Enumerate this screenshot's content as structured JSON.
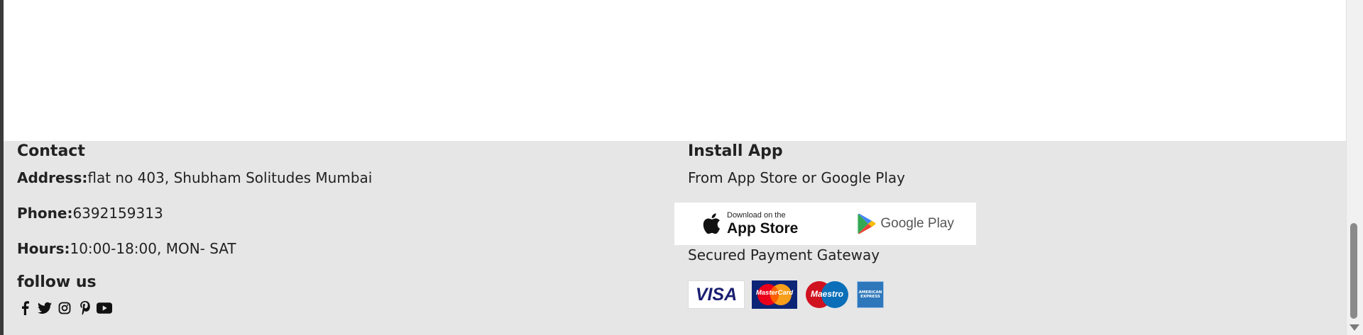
{
  "contact": {
    "heading": "Contact",
    "address_label": "Address:",
    "address_value": "flat no 403, Shubham Solitudes Mumbai",
    "phone_label": "Phone:",
    "phone_value": "6392159313",
    "hours_label": "Hours:",
    "hours_value": "10:00-18:00, MON- SAT",
    "follow_heading": "follow us",
    "social_icons": [
      "facebook-icon",
      "twitter-icon",
      "instagram-icon",
      "pinterest-icon",
      "youtube-icon"
    ]
  },
  "install_app": {
    "heading": "Install App",
    "subtitle": "From App Store or Google Play",
    "app_store_small": "Download on the",
    "app_store_big": "App Store",
    "google_play": "Google Play",
    "payment_heading": "Secured Payment Gateway",
    "cards": [
      "VISA",
      "MasterCard",
      "Maestro",
      "AMERICAN EXPRESS"
    ]
  },
  "colors": {
    "footer_bg": "#e6e6e6",
    "text": "#222222",
    "visa_blue": "#1a1f71",
    "mastercard_red": "#eb001b",
    "mastercard_orange": "#f79e1b",
    "amex_blue": "#2e77bb"
  }
}
